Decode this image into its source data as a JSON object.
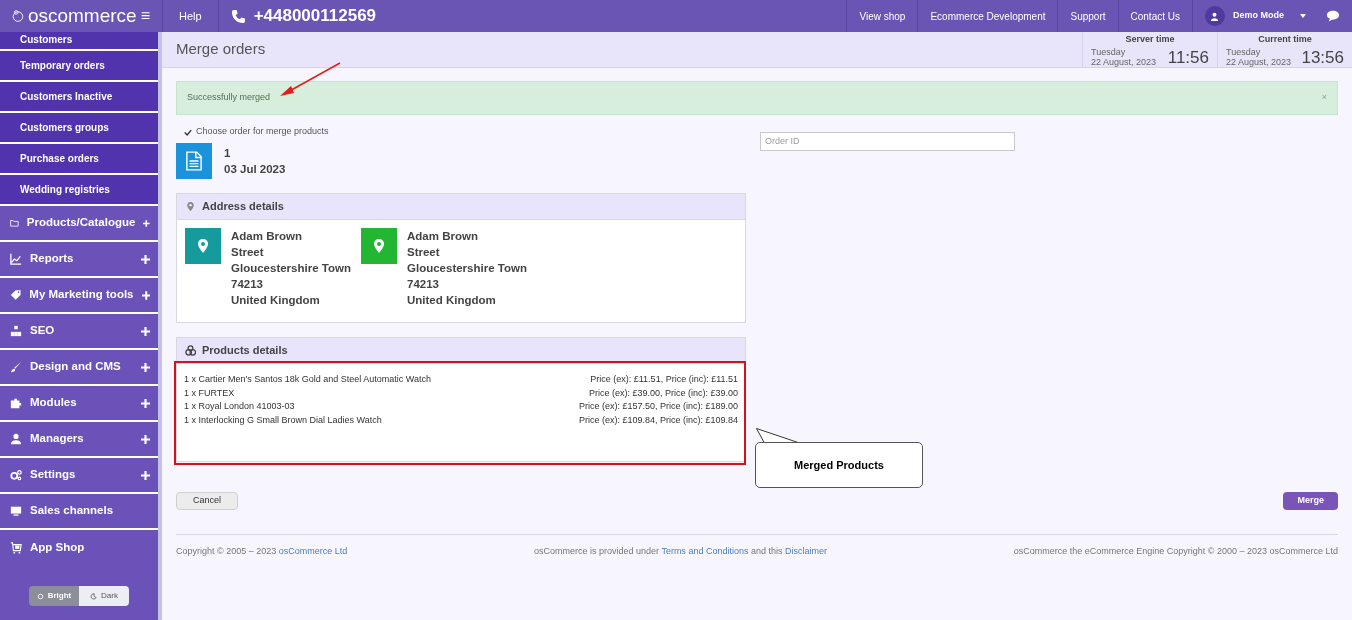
{
  "topbar": {
    "logo": "oscommerce",
    "menu_glyph": "≡",
    "help": "Help",
    "phone": "+448000112569",
    "links": [
      "View shop",
      "Ecommerce Development",
      "Support",
      "Contact Us"
    ],
    "user": "Demo Mode"
  },
  "sidebar": {
    "sub_items": [
      "Customers",
      "Temporary orders",
      "Customers Inactive",
      "Customers groups",
      "Purchase orders",
      "Wedding registries"
    ],
    "sections": [
      {
        "label": "Products/Catalogue",
        "expandable": true
      },
      {
        "label": "Reports",
        "expandable": true
      },
      {
        "label": "My Marketing tools",
        "expandable": true
      },
      {
        "label": "SEO",
        "expandable": true
      },
      {
        "label": "Design and CMS",
        "expandable": true
      },
      {
        "label": "Modules",
        "expandable": true
      },
      {
        "label": "Managers",
        "expandable": true
      },
      {
        "label": "Settings",
        "expandable": true
      },
      {
        "label": "Sales channels",
        "expandable": false
      },
      {
        "label": "App Shop",
        "expandable": false
      }
    ],
    "theme": [
      {
        "label": "Bright",
        "selected": true
      },
      {
        "label": "Dark",
        "selected": false
      }
    ]
  },
  "page": {
    "title": "Merge orders",
    "clocks": [
      {
        "label": "Server time",
        "day": "Tuesday",
        "date": "22 August, 2023",
        "time": "11:56"
      },
      {
        "label": "Current time",
        "day": "Tuesday",
        "date": "22 August, 2023",
        "time": "13:56"
      }
    ]
  },
  "alert": {
    "message": "Successfully merged",
    "close": "×"
  },
  "choose_label": "Choose order for merge products",
  "order_id": {
    "placeholder": "Order ID"
  },
  "order": {
    "number": "1",
    "date": "03 Jul 2023"
  },
  "address": {
    "title": "Address details",
    "addresses": [
      {
        "color": "#159b9b",
        "lines": [
          "Adam Brown",
          "Street",
          "Gloucestershire Town",
          "74213",
          "United Kingdom"
        ]
      },
      {
        "color": "#22b633",
        "lines": [
          "Adam Brown",
          "Street",
          "Gloucestershire Town",
          "74213",
          "United Kingdom"
        ]
      }
    ]
  },
  "products": {
    "title": "Products details",
    "items": [
      {
        "name": "1 x Cartier Men's Santos 18k Gold and Steel Automatic Watch",
        "price": "Price (ex): £11.51, Price (inc): £11.51"
      },
      {
        "name": "1 x FURTEX",
        "price": "Price (ex): £39.00, Price (inc): £39.00"
      },
      {
        "name": "1 x Royal London 41003-03",
        "price": "Price (ex): £157.50, Price (inc): £189.00"
      },
      {
        "name": "1 x Interlocking G Small Brown Dial Ladies Watch",
        "price": "Price (ex): £109.84, Price (inc): £109.84"
      }
    ]
  },
  "callout": "Merged Products",
  "buttons": {
    "cancel": "Cancel",
    "merge": "Merge"
  },
  "footer": {
    "left": [
      {
        "text": "Copyright © 2005 – 2023 ",
        "link": false
      },
      {
        "text": "osCommerce Ltd",
        "link": true
      }
    ],
    "center": [
      {
        "text": "osCommerce is provided under ",
        "link": false
      },
      {
        "text": "Terms and Conditions",
        "link": true
      },
      {
        "text": " and this ",
        "link": false
      },
      {
        "text": "Disclaimer",
        "link": true
      }
    ],
    "right": [
      {
        "text": "osCommerce the eCommerce Engine Copyright © 2000 – 2023 osCommerce Ltd",
        "link": false
      }
    ]
  }
}
